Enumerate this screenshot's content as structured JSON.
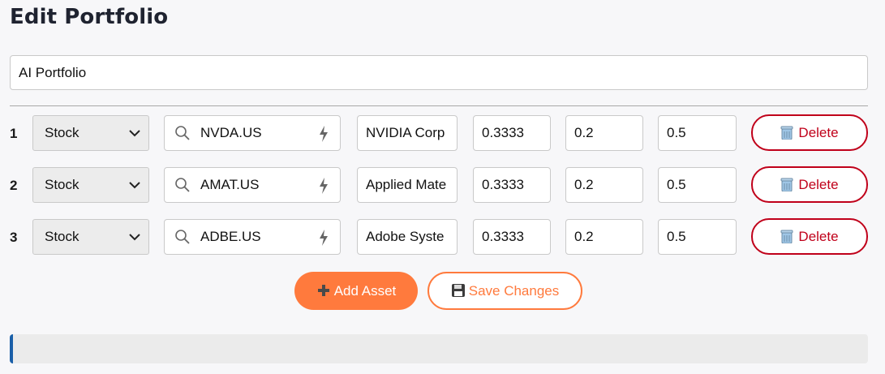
{
  "page": {
    "title": "Edit Portfolio"
  },
  "portfolio": {
    "name": "AI Portfolio"
  },
  "assets": [
    {
      "index": "1",
      "type": "Stock",
      "symbol": "NVDA.US",
      "name": "NVIDIA Corp",
      "v1": "0.3333",
      "v2": "0.2",
      "v3": "0.5",
      "delete_label": "Delete"
    },
    {
      "index": "2",
      "type": "Stock",
      "symbol": "AMAT.US",
      "name": "Applied Mate",
      "v1": "0.3333",
      "v2": "0.2",
      "v3": "0.5",
      "delete_label": "Delete"
    },
    {
      "index": "3",
      "type": "Stock",
      "symbol": "ADBE.US",
      "name": "Adobe Syste",
      "v1": "0.3333",
      "v2": "0.2",
      "v3": "0.5",
      "delete_label": "Delete"
    }
  ],
  "actions": {
    "add_label": "Add Asset",
    "save_label": "Save Changes"
  },
  "colors": {
    "accent": "#ff7a3d",
    "danger": "#c0001a",
    "status_border": "#1a5fa8"
  },
  "icons": {
    "search": "search-icon",
    "bolt": "bolt-icon",
    "trash": "trash-icon",
    "plus": "plus-icon",
    "save": "floppy-disk-icon",
    "chevron": "chevron-down-icon"
  }
}
